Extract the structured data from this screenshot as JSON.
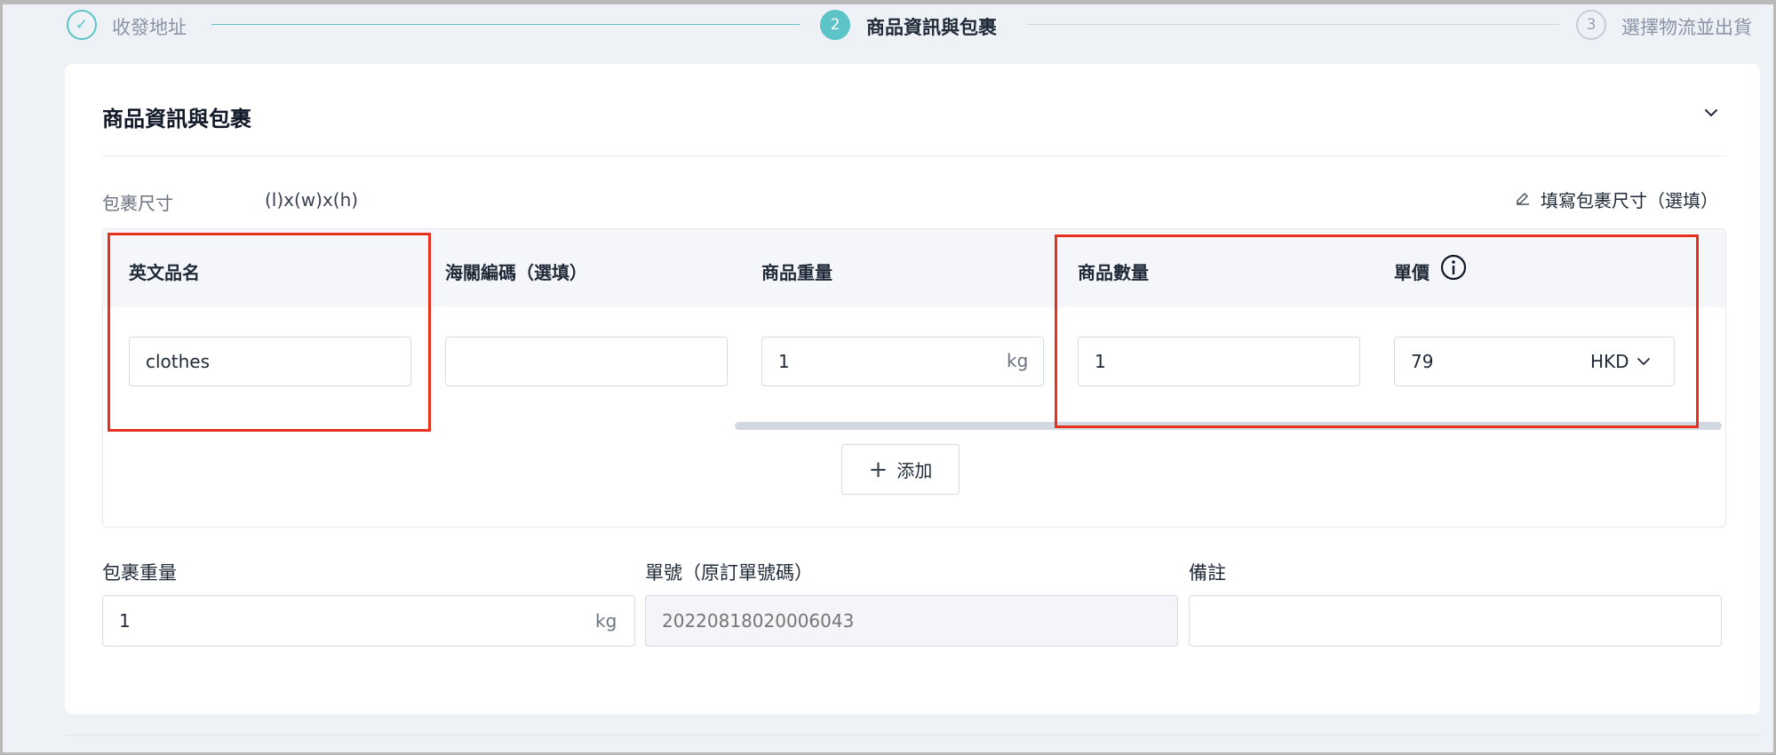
{
  "stepper": {
    "steps": [
      {
        "number": "✓",
        "label": "收發地址",
        "state": "done"
      },
      {
        "number": "2",
        "label": "商品資訊與包裹",
        "state": "active"
      },
      {
        "number": "3",
        "label": "選擇物流並出貨",
        "state": "pending"
      }
    ]
  },
  "card": {
    "title": "商品資訊與包裹",
    "collapse_icon": "chevron-down-icon"
  },
  "dimensions": {
    "label": "包裹尺寸",
    "value": "(l)x(w)x(h)",
    "fill_link": "填寫包裹尺寸（選填）",
    "fill_icon": "edit-icon"
  },
  "table": {
    "headers": {
      "name": "英文品名",
      "hs_code": "海關編碼（選填）",
      "weight": "商品重量",
      "quantity": "商品數量",
      "unit_price": "單價"
    },
    "row": {
      "name": "clothes",
      "hs_code": "",
      "weight": "1",
      "weight_unit": "kg",
      "quantity": "1",
      "unit_price": "79",
      "currency": "HKD"
    },
    "add_label": "添加"
  },
  "package": {
    "weight_label": "包裹重量",
    "weight_value": "1",
    "weight_unit": "kg",
    "order_label": "單號（原訂單號碼）",
    "order_placeholder": "20220818020006043",
    "remark_label": "備註",
    "remark_value": ""
  },
  "colors": {
    "accent": "#5cc3c6",
    "highlight": "#e8321e",
    "background": "#eef1f6"
  }
}
